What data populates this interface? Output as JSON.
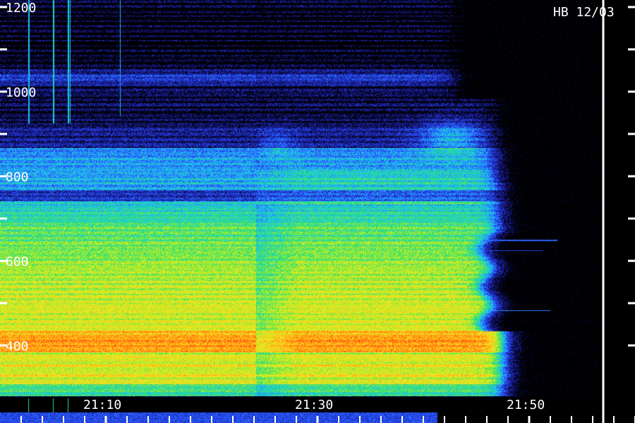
{
  "chart_data": {
    "type": "heatmap",
    "title": "HB 12/03",
    "xlabel": "",
    "ylabel": "",
    "x_tick_labels": [
      "21:10",
      "21:30",
      "21:50"
    ],
    "y_tick_values": [
      400,
      600,
      800,
      1000,
      1200
    ],
    "y_tick_labels": [
      "400",
      "600",
      "800",
      "1000",
      "1200"
    ],
    "xlim_minutes_after_21h": [
      2,
      60
    ],
    "ylim": [
      330,
      1200
    ],
    "major_y_step": 200,
    "minor_y_step": 100,
    "x_minor_step_minutes": 2,
    "x_major_step_minutes": 20,
    "grid": false,
    "series_bands": [
      {
        "start_minute": 2,
        "end_minute": 26
      },
      {
        "start_minute": 26,
        "end_minute": 50
      }
    ]
  },
  "colors": {
    "background": "#000000",
    "axis": "#ffffff",
    "colormap": [
      "#000000",
      "#1a1aa0",
      "#2a55ff",
      "#20c8ff",
      "#20e070",
      "#c8f020",
      "#ffe020",
      "#ff9010",
      "#ff2a10"
    ]
  }
}
